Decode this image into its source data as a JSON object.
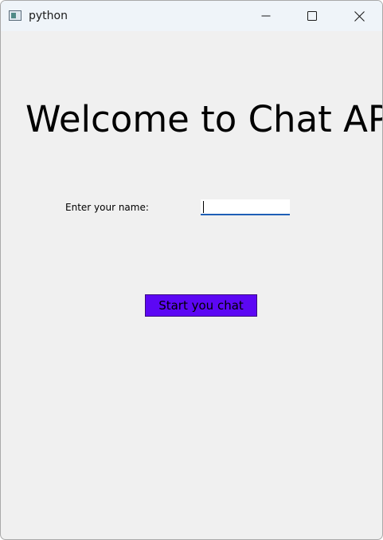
{
  "window": {
    "title": "python",
    "icons": {
      "app": "app-window-icon",
      "minimize": "minimize-icon",
      "maximize": "maximize-icon",
      "close": "close-icon"
    }
  },
  "main": {
    "heading": "Welcome to Chat APP",
    "name_label": "Enter your name:",
    "name_input": {
      "value": "",
      "placeholder": ""
    },
    "start_button_label": "Start you chat"
  },
  "colors": {
    "titlebar": "#eff4f9",
    "background": "#f0f0f0",
    "start_button": "#5c07f4",
    "input_underline": "#1f5fb6"
  }
}
